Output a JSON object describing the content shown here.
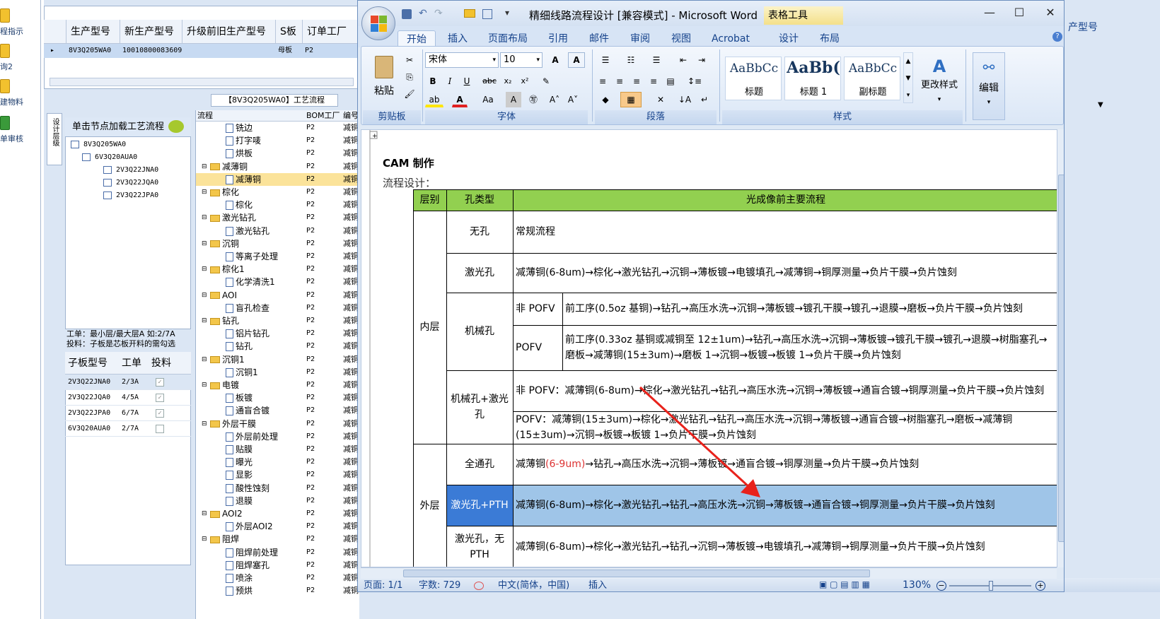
{
  "left_strip": {
    "items": [
      "程指示",
      "询2",
      "建物料",
      "单审核"
    ]
  },
  "bg_grid": {
    "columns": [
      "生产型号",
      "新生产型号",
      "升级前旧生产型号",
      "S板",
      "订单工厂"
    ],
    "row": {
      "c1": "8V3Q205WA0",
      "c2": "10010800083609",
      "c3": "",
      "c4": "母板",
      "c5": "P2"
    },
    "right_header": "产型号"
  },
  "process_tab": "【8V3Q205WA0】工艺流程",
  "tree": {
    "header": "单击节点加载工艺流程",
    "nodes": [
      "8V3Q205WA0",
      "6V3Q20AUA0",
      "2V3Q22JNA0",
      "2V3Q22JQA0",
      "2V3Q22JPA0"
    ]
  },
  "side_tab": "设计层级",
  "info": {
    "line1": "工单：最小层/最大层A 如:2/7A",
    "line2": "投料：子板是芯板开料的需勾选"
  },
  "sub_table": {
    "headers": [
      "子板型号",
      "工单",
      "投料"
    ],
    "rows": [
      {
        "model": "2V3Q22JNA0",
        "order": "2/3A",
        "checked": true
      },
      {
        "model": "2V3Q22JQA0",
        "order": "4/5A",
        "checked": true
      },
      {
        "model": "2V3Q22JPA0",
        "order": "6/7A",
        "checked": true
      },
      {
        "model": "6V3Q20AUA0",
        "order": "2/7A",
        "checked": false
      }
    ]
  },
  "flow_list": {
    "headers": [
      "流程",
      "BOM工厂",
      "编号"
    ],
    "rows": [
      {
        "name": "铣边",
        "indent": 2,
        "code": "P2",
        "folder": false
      },
      {
        "name": "打字唛",
        "indent": 2,
        "code": "P2",
        "folder": false
      },
      {
        "name": "烘板",
        "indent": 2,
        "code": "P2",
        "folder": false
      },
      {
        "name": "减薄铜",
        "indent": 1,
        "code": "P2",
        "folder": true
      },
      {
        "name": "减薄铜",
        "indent": 2,
        "code": "P2",
        "folder": false,
        "selected": true
      },
      {
        "name": "棕化",
        "indent": 1,
        "code": "P2",
        "folder": true
      },
      {
        "name": "棕化",
        "indent": 2,
        "code": "P2",
        "folder": false
      },
      {
        "name": "激光钻孔",
        "indent": 1,
        "code": "P2",
        "folder": true
      },
      {
        "name": "激光钻孔",
        "indent": 2,
        "code": "P2",
        "folder": false
      },
      {
        "name": "沉铜",
        "indent": 1,
        "code": "P2",
        "folder": true
      },
      {
        "name": "等离子处理",
        "indent": 2,
        "code": "P2",
        "folder": false
      },
      {
        "name": "棕化1",
        "indent": 1,
        "code": "P2",
        "folder": true
      },
      {
        "name": "化学清洗1",
        "indent": 2,
        "code": "P2",
        "folder": false
      },
      {
        "name": "AOI",
        "indent": 1,
        "code": "P2",
        "folder": true
      },
      {
        "name": "盲孔检查",
        "indent": 2,
        "code": "P2",
        "folder": false
      },
      {
        "name": "钻孔",
        "indent": 1,
        "code": "P2",
        "folder": true
      },
      {
        "name": "铝片钻孔",
        "indent": 2,
        "code": "P2",
        "folder": false
      },
      {
        "name": "钻孔",
        "indent": 2,
        "code": "P2",
        "folder": false
      },
      {
        "name": "沉铜1",
        "indent": 1,
        "code": "P2",
        "folder": true
      },
      {
        "name": "沉铜1",
        "indent": 2,
        "code": "P2",
        "folder": false
      },
      {
        "name": "电镀",
        "indent": 1,
        "code": "P2",
        "folder": true
      },
      {
        "name": "板镀",
        "indent": 2,
        "code": "P2",
        "folder": false
      },
      {
        "name": "通盲合镀",
        "indent": 2,
        "code": "P2",
        "folder": false
      },
      {
        "name": "外层干膜",
        "indent": 1,
        "code": "P2",
        "folder": true
      },
      {
        "name": "外层前处理",
        "indent": 2,
        "code": "P2",
        "folder": false
      },
      {
        "name": "贴膜",
        "indent": 2,
        "code": "P2",
        "folder": false
      },
      {
        "name": "曝光",
        "indent": 2,
        "code": "P2",
        "folder": false
      },
      {
        "name": "显影",
        "indent": 2,
        "code": "P2",
        "folder": false
      },
      {
        "name": "酸性蚀刻",
        "indent": 2,
        "code": "P2",
        "folder": false
      },
      {
        "name": "退膜",
        "indent": 2,
        "code": "P2",
        "folder": false
      },
      {
        "name": "AOI2",
        "indent": 1,
        "code": "P2",
        "folder": true
      },
      {
        "name": "外层AOI2",
        "indent": 2,
        "code": "P2",
        "folder": false
      },
      {
        "name": "阻焊",
        "indent": 1,
        "code": "P2",
        "folder": true
      },
      {
        "name": "阻焊前处理",
        "indent": 2,
        "code": "P2",
        "folder": false
      },
      {
        "name": "阻焊塞孔",
        "indent": 2,
        "code": "P2",
        "folder": false
      },
      {
        "name": "喷涂",
        "indent": 2,
        "code": "P2",
        "folder": false
      },
      {
        "name": "预烘",
        "indent": 2,
        "code": "P2",
        "folder": false
      }
    ],
    "extra": "减铜"
  },
  "word": {
    "title": "精细线路流程设计 [兼容模式] - Microsoft Word",
    "contextual_tab": "表格工具",
    "tabs": [
      "开始",
      "插入",
      "页面布局",
      "引用",
      "邮件",
      "审阅",
      "视图",
      "Acrobat",
      "设计",
      "布局"
    ],
    "active_tab": "开始",
    "ribbon": {
      "paste": "粘贴",
      "clipboard": "剪贴板",
      "font_name": "宋体",
      "font_size": "10",
      "font_group": "字体",
      "paragraph_group": "段落",
      "styles_group": "样式",
      "styles": [
        {
          "sample": "AaBbCc",
          "name": "标题"
        },
        {
          "sample": "AaBb(",
          "name": "标题 1"
        },
        {
          "sample": "AaBbCc",
          "name": "副标题"
        }
      ],
      "change_styles": "更改样式",
      "edit": "编辑"
    },
    "status": {
      "page": "页面: 1/1",
      "words": "字数: 729",
      "lang": "中文(简体，中国)",
      "mode": "插入",
      "zoom": "130%"
    }
  },
  "document": {
    "heading": "CAM 制作",
    "subheading": "流程设计：",
    "table": {
      "headers": [
        "层别",
        "孔类型",
        "光成像前主要流程"
      ],
      "inner_layer": "内层",
      "outer_layer": "外层",
      "rows": [
        {
          "type": "无孔",
          "flow": "常规流程"
        },
        {
          "type": "激光孔",
          "flow": "减薄铜(6-8um)→棕化→激光钻孔→沉铜→薄板镀→电镀填孔→减薄铜→铜厚测量→负片干膜→负片蚀刻"
        },
        {
          "type": "机械孔",
          "sub": "非 POFV",
          "flow": "前工序(0.5oz 基铜)→钻孔→高压水洗→沉铜→薄板镀→镀孔干膜→镀孔→退膜→磨板→负片干膜→负片蚀刻"
        },
        {
          "type": "",
          "sub": "POFV",
          "flow": "前工序(0.33oz 基铜或减铜至 12±1um)→钻孔→高压水洗→沉铜→薄板镀→镀孔干膜→镀孔→退膜→树脂塞孔→磨板→减薄铜(15±3um)→磨板 1→沉铜→板镀→板镀 1→负片干膜→负片蚀刻"
        },
        {
          "type": "机械孔+激光孔",
          "flow": "非 POFV：减薄铜(6-8um)→棕化→激光钻孔→钻孔→高压水洗→沉铜→薄板镀→通盲合镀→铜厚测量→负片干膜→负片蚀刻"
        },
        {
          "type": "",
          "flow": "POFV：减薄铜(15±3um)→棕化→激光钻孔→钻孔→高压水洗→沉铜→薄板镀→通盲合镀→树脂塞孔→磨板→减薄铜(15±3um)→沉铜→板镀→板镀 1→负片干膜→负片蚀刻"
        },
        {
          "type": "全通孔",
          "flow_a": "减薄铜",
          "flow_red": "(6-9um)",
          "flow_b": "→钻孔→高压水洗→沉铜→薄板镀→通盲合镀→铜厚测量→负片干膜→负片蚀刻"
        },
        {
          "type": "激光孔+PTH",
          "flow": "减薄铜(6-8um)→棕化→激光钻孔→钻孔→高压水洗→沉铜→薄板镀→通盲合镀→铜厚测量→负片干膜→负片蚀刻",
          "selected": true
        },
        {
          "type": "激光孔，无PTH",
          "flow": "减薄铜(6-8um)→棕化→激光钻孔→钻孔→沉铜→薄板镀→电镀填孔→减薄铜→铜厚测量→负片干膜→负片蚀刻"
        }
      ]
    }
  },
  "colors": {
    "header_green": "#92d050",
    "selection_blue": "#9fc5e8",
    "arrow_red": "#e8221b",
    "word_blue": "#15428b"
  }
}
